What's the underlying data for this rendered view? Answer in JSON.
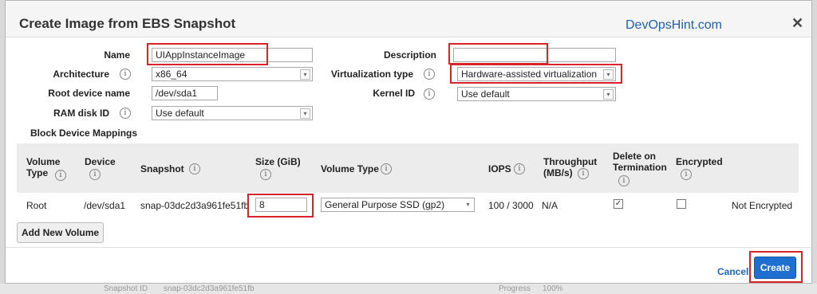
{
  "dialog": {
    "title": "Create Image from EBS Snapshot",
    "watermark": "DevOpsHint.com",
    "close_glyph": "✕"
  },
  "form": {
    "name_label": "Name",
    "name_value": "UIAppInstanceImage",
    "description_label": "Description",
    "description_value": "",
    "architecture_label": "Architecture",
    "architecture_value": "x86_64",
    "virtualization_label": "Virtualization type",
    "virtualization_value": "Hardware-assisted virtualization",
    "root_device_label": "Root device name",
    "root_device_value": "/dev/sda1",
    "kernel_label": "Kernel ID",
    "kernel_value": "Use default",
    "ramdisk_label": "RAM disk ID",
    "ramdisk_value": "Use default",
    "block_device_label": "Block Device Mappings"
  },
  "table": {
    "headers": {
      "volume_type_1": "Volume",
      "volume_type_2": "Type",
      "device_1": "Device",
      "snapshot": "Snapshot",
      "size_1": "Size (GiB)",
      "volume_type_col": "Volume Type",
      "iops": "IOPS",
      "throughput_1": "Throughput",
      "throughput_2": "(MB/s)",
      "delete_1": "Delete on",
      "delete_2": "Termination",
      "encrypted": "Encrypted"
    },
    "row": {
      "volume": "Root",
      "device": "/dev/sda1",
      "snapshot": "snap-03dc2d3a961fe51fb",
      "size": "8",
      "volume_type": "General Purpose SSD (gp2)",
      "iops": "100 / 3000",
      "throughput": "N/A",
      "delete_on_termination": true,
      "encrypted": false,
      "encryption_status": "Not Encrypted"
    }
  },
  "buttons": {
    "add_volume": "Add New Volume",
    "cancel": "Cancel",
    "create": "Create"
  },
  "background": {
    "snapshot_id_label": "Snapshot ID",
    "snapshot_id_value": "snap-03dc2d3a961fe51fb",
    "progress_label": "Progress",
    "progress_value": "100%"
  },
  "icons": {
    "info": "i",
    "dropdown": "▾",
    "check": "✓"
  },
  "colors": {
    "highlight": "#d9232b",
    "primary_button": "#1f6fd0",
    "link": "#1a66c2"
  }
}
